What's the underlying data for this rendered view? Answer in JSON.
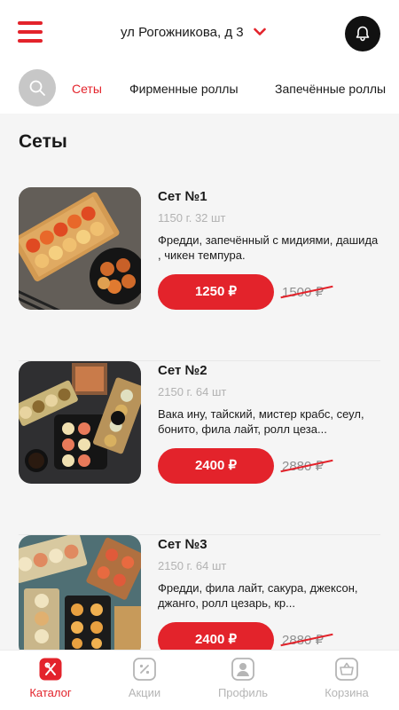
{
  "header": {
    "address": "ул Рогожникова, д 3"
  },
  "tabs": [
    {
      "label": "Сеты",
      "active": true
    },
    {
      "label": "Фирменные роллы",
      "active": false
    },
    {
      "label": "Запечённые роллы",
      "active": false
    }
  ],
  "section": {
    "title": "Сеты"
  },
  "products": [
    {
      "name": "Сет №1",
      "meta": "1150 г. 32 шт",
      "description": "Фредди, запечённый с мидиями, дашида , чикен темпура.",
      "price": "1250 ₽",
      "old_price": "1500 ₽"
    },
    {
      "name": "Сет №2",
      "meta": "2150 г. 64 шт",
      "description": "Вака ину, тайский, мистер крабс, сеул, бонито, фила лайт, ролл цеза...",
      "price": "2400 ₽",
      "old_price": "2880 ₽"
    },
    {
      "name": "Сет №3",
      "meta": "2150 г. 64 шт",
      "description": "Фредди, фила лайт, сакура, джексон, джанго, ролл цезарь, кр...",
      "price": "2400 ₽",
      "old_price": "2880 ₽"
    }
  ],
  "bottom_nav": [
    {
      "label": "Каталог",
      "active": true
    },
    {
      "label": "Акции",
      "active": false
    },
    {
      "label": "Профиль",
      "active": false
    },
    {
      "label": "Корзина",
      "active": false
    }
  ],
  "colors": {
    "accent": "#e3232b",
    "inactive": "#b5b5b5",
    "background": "#f5f5f5"
  }
}
